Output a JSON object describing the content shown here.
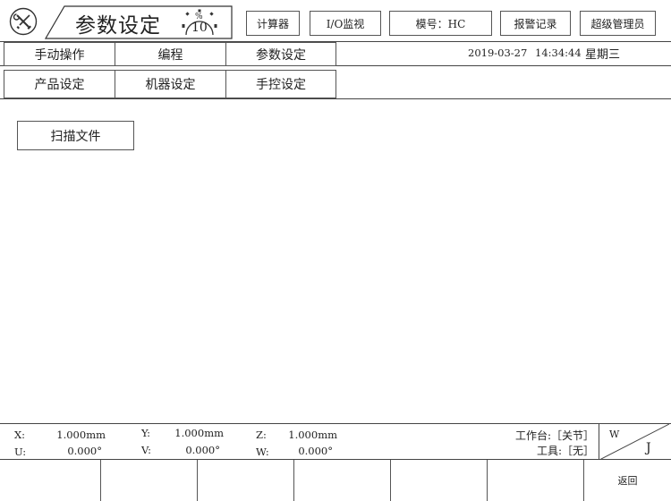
{
  "header": {
    "title": "参数设定",
    "counter_top": "%",
    "counter_bottom": "10",
    "buttons": [
      {
        "label": "计算器"
      },
      {
        "label": "I/O监视"
      },
      {
        "label": "模号：HC"
      },
      {
        "label": "报警记录"
      },
      {
        "label": "超级管理员"
      }
    ]
  },
  "tabs_row1": [
    {
      "label": "手动操作"
    },
    {
      "label": "编程"
    },
    {
      "label": "参数设定"
    }
  ],
  "datetime": {
    "date": "2019-03-27",
    "time": "14:34:44",
    "weekday": "星期三"
  },
  "tabs_row2": [
    {
      "label": "产品设定"
    },
    {
      "label": "机器设定"
    },
    {
      "label": "手控设定"
    }
  ],
  "main": {
    "scan_button": "扫描文件"
  },
  "status": {
    "x_label": "X:",
    "x_value": "1.000mm",
    "y_label": "Y:",
    "y_value": "1.000mm",
    "z_label": "Z:",
    "z_value": "1.000mm",
    "u_label": "U:",
    "u_value": "0.000°",
    "v_label": "V:",
    "v_value": "0.000°",
    "w_label": "W:",
    "w_value": "0.000°",
    "worktable": "工作台:［关节］",
    "tool": "工具:［无］",
    "corner_top": "W",
    "corner_bottom": "J"
  },
  "func_keys": [
    "",
    "",
    "",
    "",
    "",
    "",
    "返回"
  ]
}
